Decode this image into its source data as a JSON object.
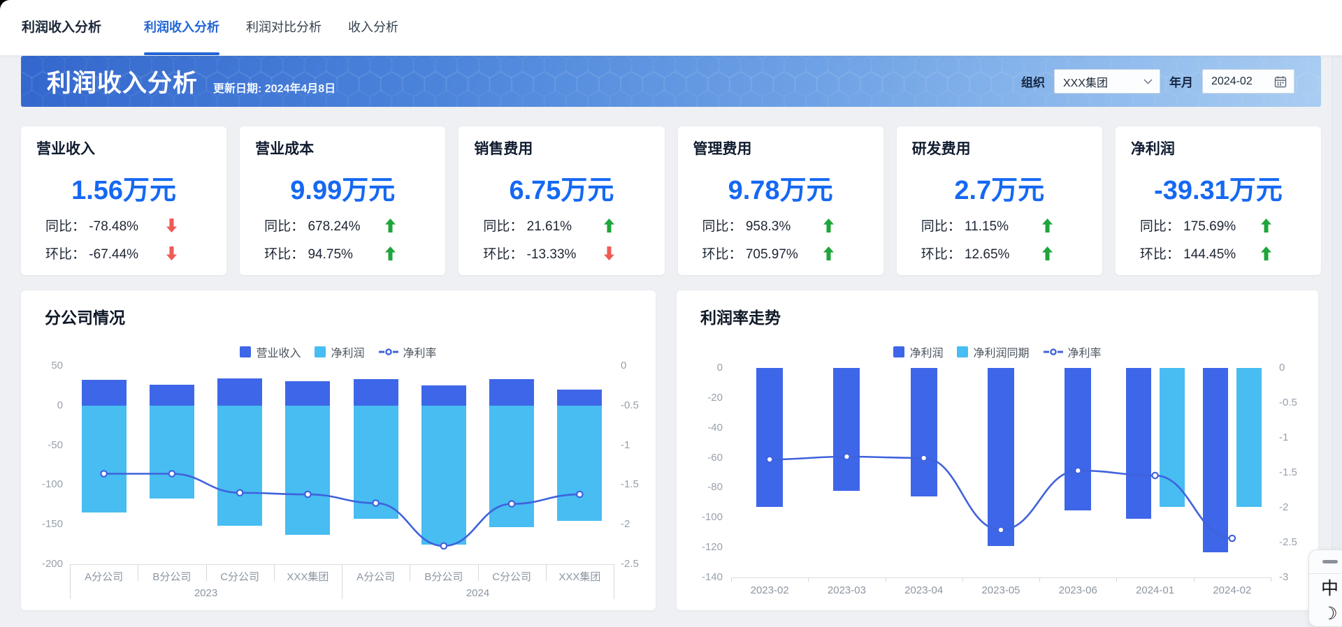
{
  "nav": {
    "title": "利润收入分析",
    "tabs": [
      {
        "label": "利润收入分析",
        "active": true
      },
      {
        "label": "利润对比分析",
        "active": false
      },
      {
        "label": "收入分析",
        "active": false
      }
    ]
  },
  "header": {
    "title": "利润收入分析",
    "update_text": "更新日期: 2024年4月8日",
    "org_label": "组织",
    "org_value": "XXX集团",
    "period_label": "年月",
    "period_value": "2024-02"
  },
  "kpi_labels": {
    "yoy": "同比：",
    "mom": "环比："
  },
  "kpi_cards": [
    {
      "title": "营业收入",
      "value": "1.56万元",
      "yoy_value": "-78.48%",
      "yoy_dir": "down",
      "mom_value": "-67.44%",
      "mom_dir": "down"
    },
    {
      "title": "营业成本",
      "value": "9.99万元",
      "yoy_value": "678.24%",
      "yoy_dir": "up",
      "mom_value": "94.75%",
      "mom_dir": "up"
    },
    {
      "title": "销售费用",
      "value": "6.75万元",
      "yoy_value": "21.61%",
      "yoy_dir": "up",
      "mom_value": "-13.33%",
      "mom_dir": "down"
    },
    {
      "title": "管理费用",
      "value": "9.78万元",
      "yoy_value": "958.3%",
      "yoy_dir": "up",
      "mom_value": "705.97%",
      "mom_dir": "up"
    },
    {
      "title": "研发费用",
      "value": "2.7万元",
      "yoy_value": "11.15%",
      "yoy_dir": "up",
      "mom_value": "12.65%",
      "mom_dir": "up"
    },
    {
      "title": "净利润",
      "value": "-39.31万元",
      "yoy_value": "175.69%",
      "yoy_dir": "up",
      "mom_value": "144.45%",
      "mom_dir": "up"
    }
  ],
  "chart_data": [
    {
      "type": "bar",
      "title": "分公司情况",
      "categories": [
        "A分公司",
        "B分公司",
        "C分公司",
        "XXX集团",
        "A分公司",
        "B分公司",
        "C分公司",
        "XXX集团"
      ],
      "groups": [
        {
          "label": "2023",
          "span": 4
        },
        {
          "label": "2024",
          "span": 4
        }
      ],
      "series": [
        {
          "name": "营业收入",
          "type": "bar",
          "axis": "left",
          "color": "#3e66e8",
          "values": [
            32,
            26,
            34,
            31,
            33,
            25,
            33,
            20
          ]
        },
        {
          "name": "净利润",
          "type": "bar",
          "axis": "left",
          "color": "#47bdf2",
          "values": [
            -135,
            -117,
            -152,
            -163,
            -143,
            -175,
            -153,
            -145
          ]
        },
        {
          "name": "净利率",
          "type": "line",
          "axis": "right",
          "color": "#3f62dc",
          "values": [
            -1.36,
            -1.36,
            -1.6,
            -1.62,
            -1.73,
            -2.27,
            -1.74,
            -1.62
          ]
        }
      ],
      "left_axis": {
        "min": -200,
        "max": 50,
        "ticks": [
          "50",
          "0",
          "-50",
          "-100",
          "-150",
          "-200"
        ]
      },
      "right_axis": {
        "min": -2.5,
        "max": 0,
        "ticks": [
          "0",
          "-0.5",
          "-1",
          "-1.5",
          "-2",
          "-2.5"
        ]
      },
      "legend_position": "top-center",
      "grid": false
    },
    {
      "type": "bar",
      "title": "利润率走势",
      "categories": [
        "2023-02",
        "2023-03",
        "2023-04",
        "2023-05",
        "2023-06",
        "2024-01",
        "2024-02"
      ],
      "series": [
        {
          "name": "净利润",
          "type": "bar",
          "axis": "left",
          "color": "#3e66e8",
          "values": [
            -93,
            -82,
            -86,
            -119,
            -95,
            -101,
            -123
          ]
        },
        {
          "name": "净利润同期",
          "type": "bar",
          "axis": "left",
          "color": "#47bdf2",
          "values": [
            null,
            null,
            null,
            null,
            null,
            -93,
            -93
          ]
        },
        {
          "name": "净利率",
          "type": "line",
          "axis": "right",
          "color": "#3f62dc",
          "values": [
            -1.31,
            -1.27,
            -1.29,
            -2.32,
            -1.47,
            -1.54,
            -2.44
          ]
        }
      ],
      "left_axis": {
        "min": -140,
        "max": 0,
        "ticks": [
          "0",
          "-20",
          "-40",
          "-60",
          "-80",
          "-100",
          "-120",
          "-140"
        ]
      },
      "right_axis": {
        "min": -3,
        "max": 0,
        "ticks": [
          "0",
          "-0.5",
          "-1",
          "-1.5",
          "-2",
          "-2.5",
          "-3"
        ]
      },
      "legend_position": "top-center",
      "grid": false
    }
  ],
  "side_widget": {
    "lang_label": "中",
    "theme_glyph": "☽"
  },
  "colors": {
    "accent": "#2165d6",
    "kpi_value": "#1568f2",
    "up": "#1fa53c",
    "down": "#ee5b56",
    "bar_dark": "#3e66e8",
    "bar_light": "#47bdf2",
    "line": "#3f62dc"
  }
}
